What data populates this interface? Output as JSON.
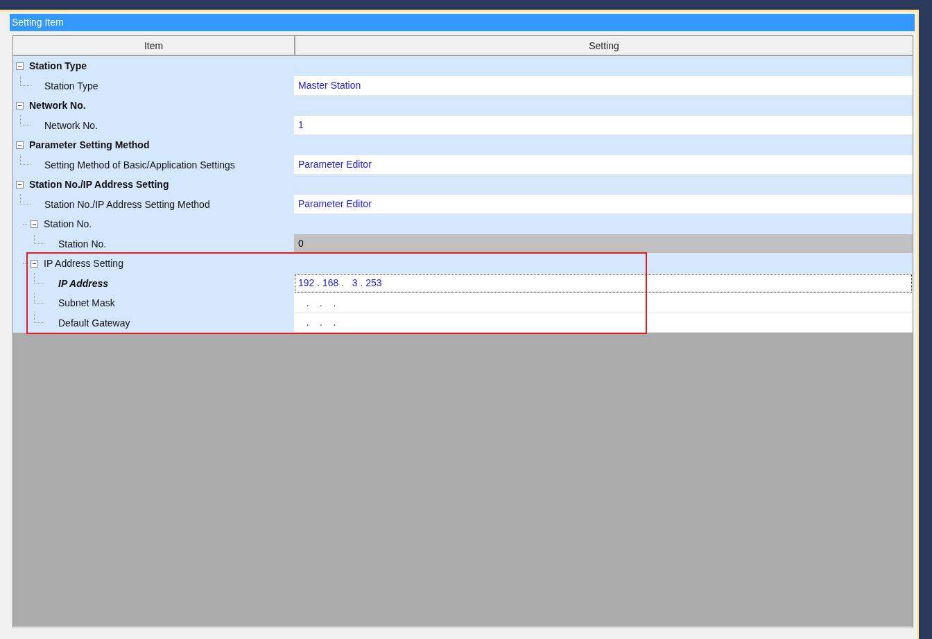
{
  "panel": {
    "title": "Setting Item"
  },
  "table": {
    "columns": [
      "Item",
      "Setting"
    ],
    "rows": [
      {
        "label": "Station Type",
        "kind": "category",
        "expanded": true,
        "children": [
          {
            "label": "Station Type",
            "value": "Master Station"
          }
        ]
      },
      {
        "label": "Network No.",
        "kind": "category",
        "expanded": true,
        "children": [
          {
            "label": "Network No.",
            "value": "1"
          }
        ]
      },
      {
        "label": "Parameter Setting Method",
        "kind": "category",
        "expanded": true,
        "children": [
          {
            "label": "Setting Method of Basic/Application Settings",
            "value": "Parameter Editor"
          }
        ]
      },
      {
        "label": "Station No./IP Address Setting",
        "kind": "category",
        "expanded": true,
        "children": [
          {
            "label": "Station No./IP Address Setting Method",
            "value": "Parameter Editor"
          },
          {
            "label": "Station No.",
            "expanded": true,
            "children": [
              {
                "label": "Station No.",
                "value": "0",
                "disabled": true
              }
            ]
          },
          {
            "label": "IP Address Setting",
            "expanded": true,
            "highlighted": true,
            "children": [
              {
                "label": "IP Address",
                "value": "192 . 168 .   3 . 253",
                "selected": true
              },
              {
                "label": "Subnet Mask",
                "value": "   .    .    .",
                "selected": false
              },
              {
                "label": "Default Gateway",
                "value": "   .    .    .",
                "selected": false
              }
            ]
          }
        ]
      }
    ]
  }
}
